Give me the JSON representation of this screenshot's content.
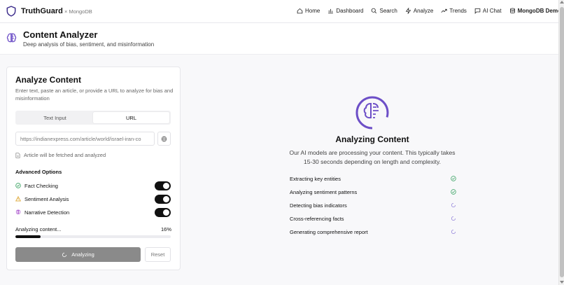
{
  "header": {
    "brand": "TruthGuard",
    "brand_sub": "× MongoDB",
    "nav": [
      {
        "label": "Home",
        "icon": "home-icon"
      },
      {
        "label": "Dashboard",
        "icon": "bar-chart-icon"
      },
      {
        "label": "Search",
        "icon": "search-icon"
      },
      {
        "label": "Analyze",
        "icon": "zap-icon"
      },
      {
        "label": "Trends",
        "icon": "trending-up-icon"
      },
      {
        "label": "AI Chat",
        "icon": "message-icon"
      },
      {
        "label": "MongoDB Demo",
        "icon": "database-icon"
      }
    ]
  },
  "page": {
    "title": "Content Analyzer",
    "subtitle": "Deep analysis of bias, sentiment, and misinformation"
  },
  "analyze_card": {
    "title": "Analyze Content",
    "description": "Enter text, paste an article, or provide a URL to analyze for bias and misinformation",
    "tabs": [
      {
        "label": "Text Input",
        "active": false
      },
      {
        "label": "URL",
        "active": true
      }
    ],
    "url_value": "https://indianexpress.com/article/world/israel-iran-co",
    "fetch_note": "Article will be fetched and analyzed",
    "advanced_title": "Advanced Options",
    "options": [
      {
        "label": "Fact Checking",
        "icon": "check-circle-icon",
        "enabled": true
      },
      {
        "label": "Sentiment Analysis",
        "icon": "warning-triangle-icon",
        "enabled": true
      },
      {
        "label": "Narrative Detection",
        "icon": "brain-icon",
        "enabled": true
      }
    ],
    "progress_label": "Analyzing content...",
    "progress_text": "16%",
    "progress_value": 16,
    "analyze_button": "Analyzing",
    "reset_button": "Reset"
  },
  "status": {
    "title": "Analyzing Content",
    "description": "Our AI models are processing your content. This typically takes 15-30 seconds depending on length and complexity.",
    "steps": [
      {
        "label": "Extracting key entities",
        "state": "done"
      },
      {
        "label": "Analyzing sentiment patterns",
        "state": "done"
      },
      {
        "label": "Detecting bias indicators",
        "state": "pending"
      },
      {
        "label": "Cross-referencing facts",
        "state": "pending"
      },
      {
        "label": "Generating comprehensive report",
        "state": "pending"
      }
    ]
  },
  "colors": {
    "accent": "#6d4fc7",
    "success": "#2f9e5a",
    "warning": "#d99a16",
    "pending": "#8d7dd8"
  }
}
